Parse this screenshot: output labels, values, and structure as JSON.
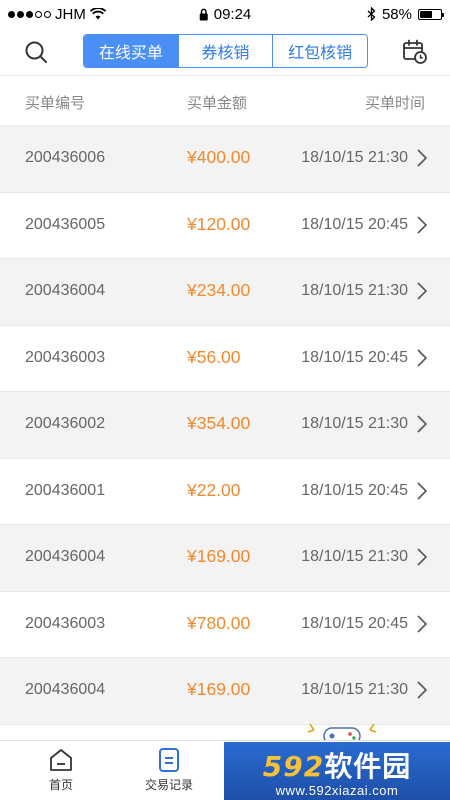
{
  "status_bar": {
    "carrier": "JHM",
    "time": "09:24",
    "battery": "58%",
    "battery_level": 0.58
  },
  "nav": {
    "tabs": [
      "在线买单",
      "券核销",
      "红包核销"
    ],
    "active_tab": 0,
    "search_icon": "search-icon",
    "calendar_icon": "calendar-clock-icon"
  },
  "table": {
    "headers": {
      "id": "买单编号",
      "amount": "买单金额",
      "time": "买单时间"
    },
    "rows": [
      {
        "id": "200436006",
        "amount": "¥400.00",
        "time": "18/10/15 21:30"
      },
      {
        "id": "200436005",
        "amount": "¥120.00",
        "time": "18/10/15 20:45"
      },
      {
        "id": "200436004",
        "amount": "¥234.00",
        "time": "18/10/15 21:30"
      },
      {
        "id": "200436003",
        "amount": "¥56.00",
        "time": "18/10/15 20:45"
      },
      {
        "id": "200436002",
        "amount": "¥354.00",
        "time": "18/10/15 21:30"
      },
      {
        "id": "200436001",
        "amount": "¥22.00",
        "time": "18/10/15 20:45"
      },
      {
        "id": "200436004",
        "amount": "¥169.00",
        "time": "18/10/15 21:30"
      },
      {
        "id": "200436003",
        "amount": "¥780.00",
        "time": "18/10/15 20:45"
      },
      {
        "id": "200436004",
        "amount": "¥169.00",
        "time": "18/10/15 21:30"
      }
    ]
  },
  "tab_bar": {
    "home": "首页",
    "records": "交易记录"
  },
  "watermark": {
    "number": "592",
    "text": "软件园",
    "url": "www.592xiazai.com"
  },
  "colors": {
    "accent": "#4a8ff5",
    "amount": "#f08a2d",
    "alt_row": "#f3f3f3"
  }
}
